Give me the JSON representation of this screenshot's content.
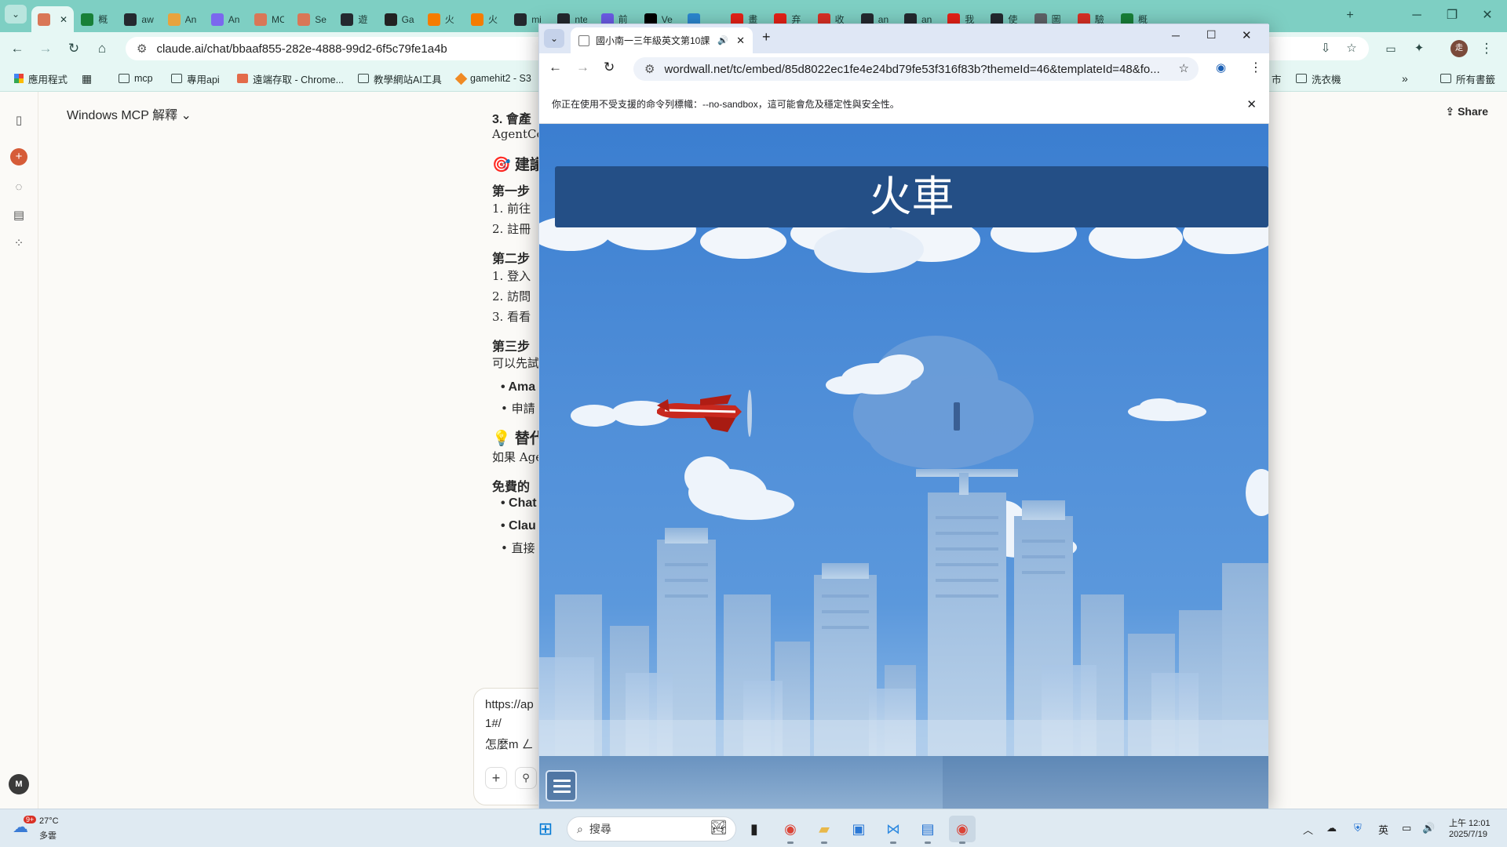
{
  "back_browser": {
    "tabs": [
      {
        "label": "",
        "icon": "claude-icon",
        "color": "#d97757",
        "active": true
      },
      {
        "label": "概",
        "icon": "sheets-icon",
        "color": "#188038"
      },
      {
        "label": "aw",
        "icon": "github-icon",
        "color": "#24292f"
      },
      {
        "label": "An",
        "icon": "app-icon",
        "color": "#e8a33d"
      },
      {
        "label": "An",
        "icon": "app-icon",
        "color": "#7b68ee"
      },
      {
        "label": "MC",
        "icon": "claude-icon",
        "color": "#d97757"
      },
      {
        "label": "Se",
        "icon": "claude-icon",
        "color": "#d97757"
      },
      {
        "label": "遊",
        "icon": "github-icon",
        "color": "#24292f"
      },
      {
        "label": "Ga",
        "icon": "app-icon",
        "color": "#222222"
      },
      {
        "label": "火",
        "icon": "fire-icon",
        "color": "#f57c00"
      },
      {
        "label": "火",
        "icon": "fire-icon",
        "color": "#f57c00"
      },
      {
        "label": "mi",
        "icon": "github-icon",
        "color": "#24292f"
      },
      {
        "label": "nte",
        "icon": "github-icon",
        "color": "#24292f"
      },
      {
        "label": "前",
        "icon": "app-icon",
        "color": "#6c5ce7"
      },
      {
        "label": "Ve",
        "icon": "vercel-icon",
        "color": "#000000"
      },
      {
        "label": "",
        "icon": "app-icon",
        "color": "#2b87d1"
      },
      {
        "label": "畫",
        "icon": "youtube-icon",
        "color": "#e62117"
      },
      {
        "label": "弃",
        "icon": "youtube-icon",
        "color": "#e62117"
      },
      {
        "label": "收",
        "icon": "gmail-icon",
        "color": "#d93025"
      },
      {
        "label": "an",
        "icon": "github-icon",
        "color": "#24292f"
      },
      {
        "label": "an",
        "icon": "github-icon",
        "color": "#24292f"
      },
      {
        "label": "我",
        "icon": "youtube-icon",
        "color": "#e62117"
      },
      {
        "label": "使",
        "icon": "github-icon",
        "color": "#24292f"
      },
      {
        "label": "圖",
        "icon": "doc-icon",
        "color": "#5f6368"
      },
      {
        "label": "驗",
        "icon": "gmail-icon",
        "color": "#d93025"
      },
      {
        "label": "概",
        "icon": "sheets-icon",
        "color": "#188038"
      }
    ],
    "url": "claude.ai/chat/bbaaf855-282e-4888-99d2-6f5c79fe1a4b",
    "bookmarks": [
      "應用程式",
      "mcp",
      "專用api",
      "遠端存取 - Chrome...",
      "教學網站AI工具",
      "gamehit2 - S3"
    ],
    "bookmarks_right": [
      "市",
      "洗衣機"
    ],
    "all_bookmarks": "所有書籤",
    "profile_initial": "走"
  },
  "claude": {
    "chat_title": "Windows MCP 解釋",
    "share_label": "Share",
    "user_initial": "M",
    "lines": [
      {
        "text": "3. 會產",
        "style": "b"
      },
      {
        "text": "AgentCo",
        "style": ""
      },
      {
        "text": "🎯 建議",
        "style": "h"
      },
      {
        "text": "第一步",
        "style": "b"
      },
      {
        "text": "1. 前往",
        "style": ""
      },
      {
        "text": "2. 註冊",
        "style": ""
      },
      {
        "text": "第二步",
        "style": "b"
      },
      {
        "text": "1. 登入",
        "style": ""
      },
      {
        "text": "2. 訪問",
        "style": ""
      },
      {
        "text": "3. 看看",
        "style": ""
      },
      {
        "text": "第三步",
        "style": "b"
      },
      {
        "text": "可以先試",
        "style": ""
      },
      {
        "text": "• Ama",
        "style": "b"
      },
      {
        "text": "• 申請",
        "style": ""
      },
      {
        "text": "💡 替代",
        "style": "h"
      },
      {
        "text": "如果 Age",
        "style": ""
      },
      {
        "text": "免費的",
        "style": "b"
      },
      {
        "text": "• Chat",
        "style": "b"
      },
      {
        "text": "• Clau",
        "style": "b"
      },
      {
        "text": "• 直接",
        "style": ""
      }
    ],
    "input_lines": [
      "https://ap",
      "1#/",
      "怎麼m ㄥ"
    ]
  },
  "popup": {
    "tab_title": "國小南一三年級英文第10課",
    "url": "wordwall.net/tc/embed/85d8022ec1fe4e24bd79fe53f316f83b?themeId=46&templateId=48&fo...",
    "infobar": "你正在使用不受支援的命令列標幟：--no-sandbox，這可能會危及穩定性與安全性。"
  },
  "game": {
    "word": "火車",
    "sky_color": "#4a8ad6"
  },
  "taskbar": {
    "weather_temp": "27°C",
    "weather_desc": "多雲",
    "weather_badge": "9+",
    "search_placeholder": "搜尋",
    "ime": "英",
    "time": "上午 12:01",
    "date": "2025/7/19"
  }
}
